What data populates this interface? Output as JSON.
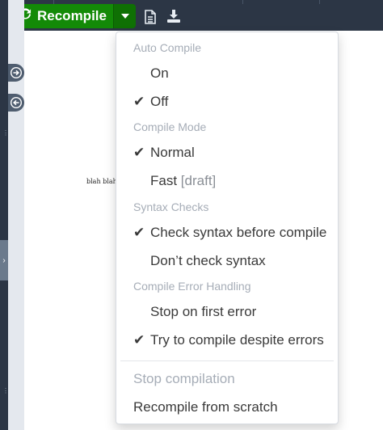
{
  "toolbar": {
    "recompile_label": "Recompile",
    "icons": [
      "refresh-icon",
      "caret-down-icon",
      "document-icon",
      "download-icon"
    ]
  },
  "pdf": {
    "text": "blah blah"
  },
  "menu": {
    "auto_compile": {
      "header": "Auto Compile",
      "on": "On",
      "off": "Off",
      "selected": "Off"
    },
    "compile_mode": {
      "header": "Compile Mode",
      "normal": "Normal",
      "fast": "Fast",
      "fast_suffix": "[draft]",
      "selected": "Normal"
    },
    "syntax_checks": {
      "header": "Syntax Checks",
      "check": "Check syntax before compile",
      "dont_check": "Don’t check syntax",
      "selected": "Check syntax before compile"
    },
    "error_handling": {
      "header": "Compile Error Handling",
      "stop": "Stop on first error",
      "try": "Try to compile despite errors",
      "selected": "Try to compile despite errors"
    },
    "stop_compilation": "Stop compilation",
    "recompile_scratch": "Recompile from scratch"
  },
  "colors": {
    "toolbar_bg": "#2c3645",
    "recompile_green": "#138a07",
    "header_gray": "#a6adb7",
    "menu_text": "#3a3a3a"
  }
}
